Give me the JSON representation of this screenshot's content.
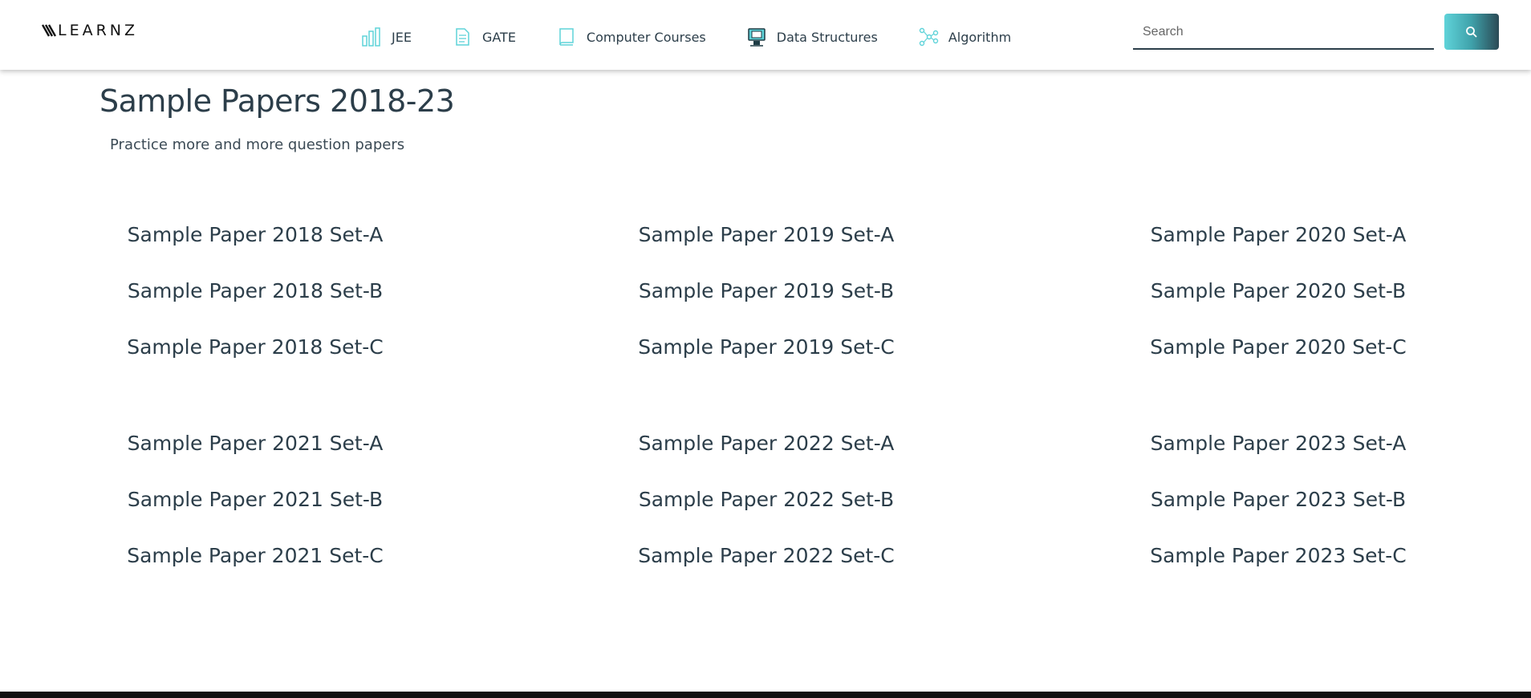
{
  "header": {
    "logo_text": "LEARNZ",
    "nav": [
      {
        "label": "JEE",
        "icon": "bar-chart-icon"
      },
      {
        "label": "GATE",
        "icon": "document-icon"
      },
      {
        "label": "Computer Courses",
        "icon": "book-icon"
      },
      {
        "label": "Data Structures",
        "icon": "computer-icon"
      },
      {
        "label": "Algorithm",
        "icon": "flowchart-icon"
      }
    ],
    "search_placeholder": "Search",
    "search_icon": "search-icon"
  },
  "page": {
    "title": "Sample Papers 2018-23",
    "subtitle": "Practice more and more question papers"
  },
  "papers": {
    "group1": {
      "col1": [
        "Sample Paper 2018 Set-A",
        "Sample Paper 2018 Set-B",
        "Sample Paper 2018 Set-C"
      ],
      "col2": [
        "Sample Paper 2019 Set-A",
        "Sample Paper 2019 Set-B",
        "Sample Paper 2019 Set-C"
      ],
      "col3": [
        "Sample Paper 2020 Set-A",
        "Sample Paper 2020 Set-B",
        "Sample Paper 2020 Set-C"
      ]
    },
    "group2": {
      "col1": [
        "Sample Paper 2021 Set-A",
        "Sample Paper 2021 Set-B",
        "Sample Paper 2021 Set-C"
      ],
      "col2": [
        "Sample Paper 2022 Set-A",
        "Sample Paper 2022 Set-B",
        "Sample Paper 2022 Set-C"
      ],
      "col3": [
        "Sample Paper 2023 Set-A",
        "Sample Paper 2023 Set-B",
        "Sample Paper 2023 Set-C"
      ]
    }
  },
  "colors": {
    "accent": "#5fd3d9",
    "text": "#2c3e4a"
  }
}
